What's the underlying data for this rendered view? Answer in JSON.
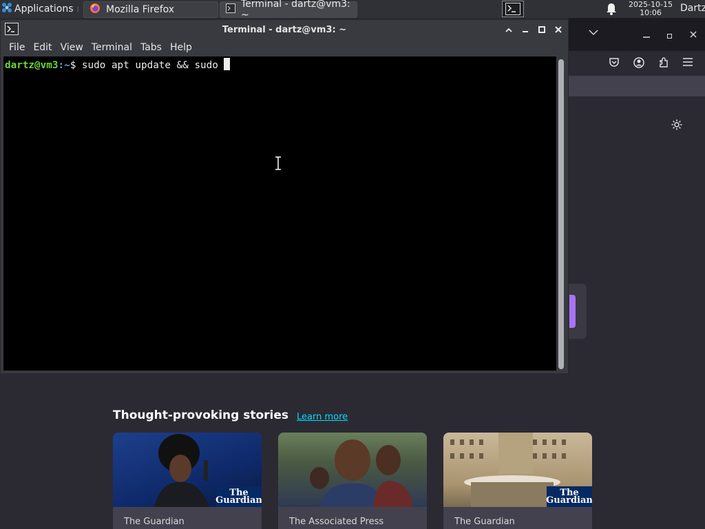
{
  "panel": {
    "applications_label": "Applications",
    "tasks": [
      {
        "label": "Mozilla Firefox",
        "icon": "firefox-icon"
      },
      {
        "label": "Terminal - dartz@vm3: ~",
        "icon": "terminal-icon"
      }
    ],
    "clock_date": "2025-10-15",
    "clock_time": "10:06",
    "user": "Dartz"
  },
  "terminal": {
    "title": "Terminal - dartz@vm3: ~",
    "menu": [
      "File",
      "Edit",
      "View",
      "Terminal",
      "Tabs",
      "Help"
    ],
    "prompt_user_host": "dartz@vm3",
    "prompt_path": ":~",
    "prompt_symbol": "$",
    "command": " sudo apt update && sudo "
  },
  "firefox": {
    "stories_title": "Thought-provoking stories",
    "learn_more": "Learn more",
    "stories": [
      {
        "source": "The Guardian",
        "badge": "The Guardian"
      },
      {
        "source": "The Associated Press",
        "badge": ""
      },
      {
        "source": "The Guardian",
        "badge": "The Guardian"
      }
    ]
  },
  "colors": {
    "accent_purple": "#a774f2",
    "link": "#00ddff",
    "prompt_green": "#6ad638"
  }
}
